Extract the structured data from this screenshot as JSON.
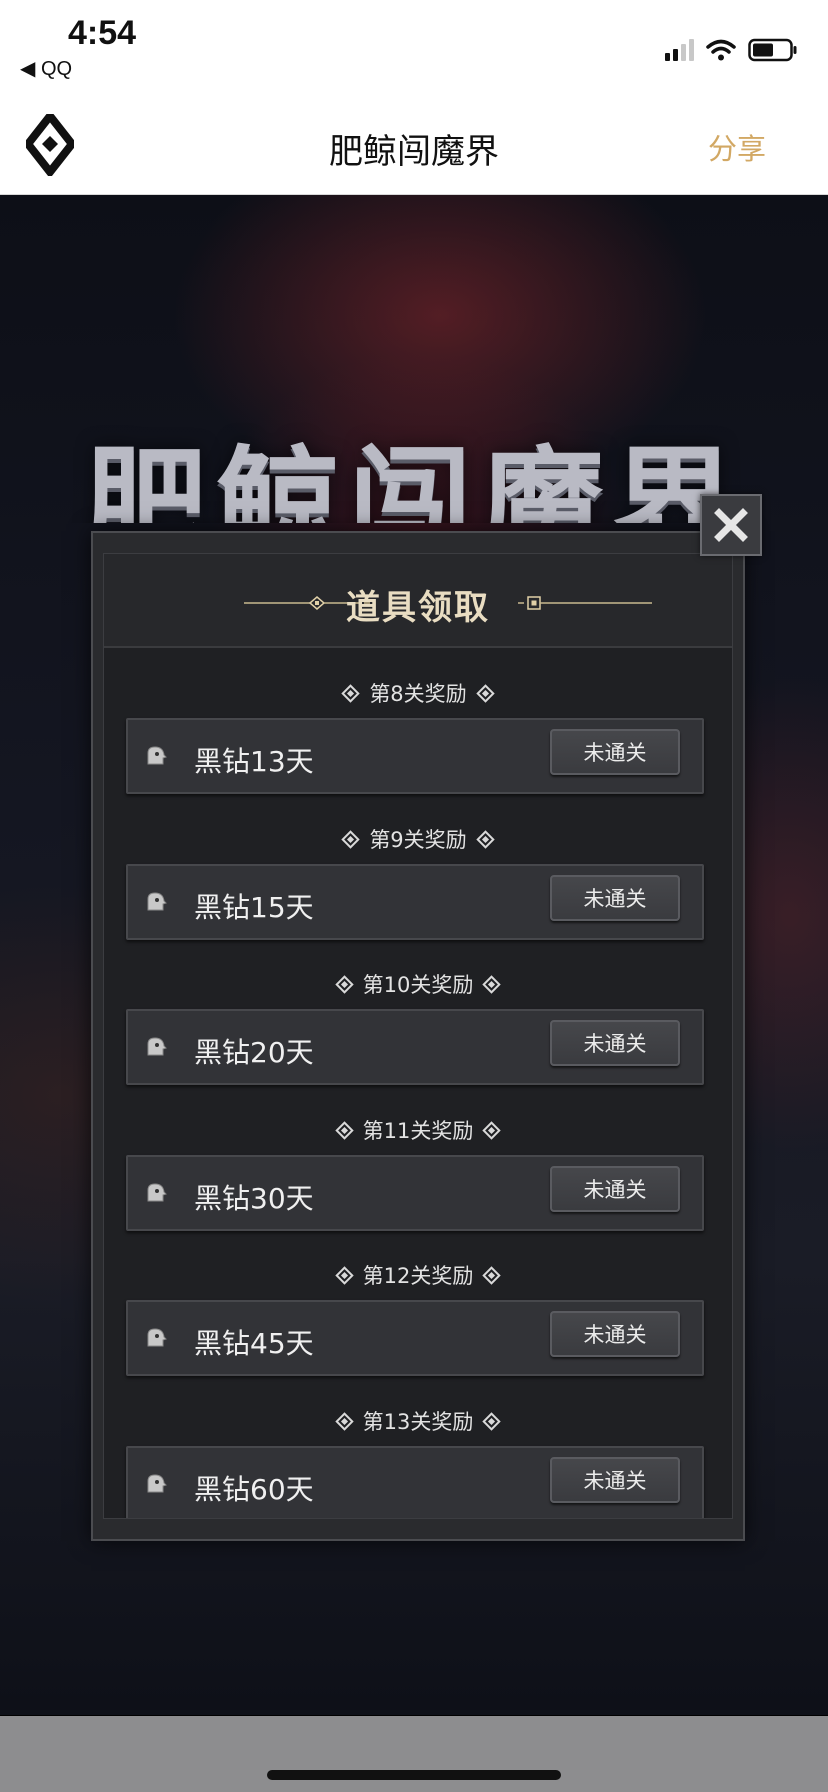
{
  "status_bar": {
    "time": "4:54",
    "back_app": "◀ QQ"
  },
  "nav": {
    "title": "肥鲸闯魔界",
    "share": "分享"
  },
  "game": {
    "title": "肥鲸闯魔界"
  },
  "modal": {
    "title": "道具领取",
    "close_icon": "close-icon",
    "rewards": [
      {
        "label": "第8关奖励",
        "item": "黑钻13天",
        "status": "未通关"
      },
      {
        "label": "第9关奖励",
        "item": "黑钻15天",
        "status": "未通关"
      },
      {
        "label": "第10关奖励",
        "item": "黑钻20天",
        "status": "未通关"
      },
      {
        "label": "第11关奖励",
        "item": "黑钻30天",
        "status": "未通关"
      },
      {
        "label": "第12关奖励",
        "item": "黑钻45天",
        "status": "未通关"
      },
      {
        "label": "第13关奖励",
        "item": "黑钻60天",
        "status": "未通关"
      }
    ]
  },
  "colors": {
    "share_accent": "#d2a864",
    "modal_title": "#e9ddc2",
    "modal_bg": "#1f2023"
  }
}
